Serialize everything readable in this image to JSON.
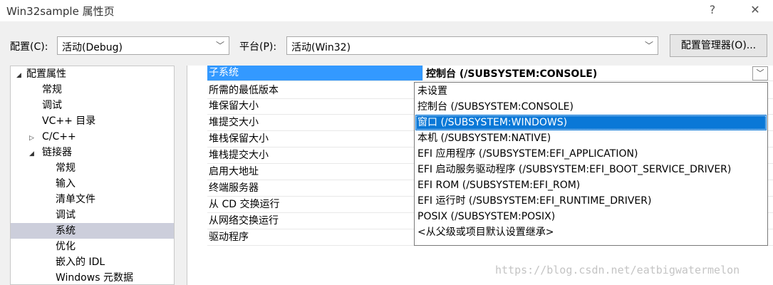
{
  "window": {
    "title": "Win32sample 属性页",
    "help_label": "?",
    "close_label": "✕"
  },
  "config_bar": {
    "config_label": "配置(C):",
    "config_value": "活动(Debug)",
    "platform_label": "平台(P):",
    "platform_value": "活动(Win32)",
    "manager_button": "配置管理器(O)..."
  },
  "tree": {
    "items": [
      {
        "label": "配置属性",
        "expander": "◢"
      },
      {
        "label": "常规"
      },
      {
        "label": "调试"
      },
      {
        "label": "VC++ 目录"
      },
      {
        "label": "C/C++",
        "expander": "▷"
      },
      {
        "label": "链接器",
        "expander": "◢"
      },
      {
        "label": "常规"
      },
      {
        "label": "输入"
      },
      {
        "label": "清单文件"
      },
      {
        "label": "调试"
      },
      {
        "label": "系统",
        "selected": true
      },
      {
        "label": "优化"
      },
      {
        "label": "嵌入的 IDL"
      },
      {
        "label": "Windows 元数据"
      }
    ]
  },
  "properties": {
    "rows": [
      {
        "name": "子系统",
        "value": "控制台 (/SUBSYSTEM:CONSOLE)",
        "selected": true
      },
      {
        "name": "所需的最低版本",
        "value": ""
      },
      {
        "name": "堆保留大小",
        "value": ""
      },
      {
        "name": "堆提交大小",
        "value": ""
      },
      {
        "name": "堆栈保留大小",
        "value": ""
      },
      {
        "name": "堆栈提交大小",
        "value": ""
      },
      {
        "name": "启用大地址",
        "value": ""
      },
      {
        "name": "终端服务器",
        "value": ""
      },
      {
        "name": "从 CD 交换运行",
        "value": ""
      },
      {
        "name": "从网络交换运行",
        "value": ""
      },
      {
        "name": "驱动程序",
        "value": ""
      }
    ]
  },
  "dropdown": {
    "options": [
      "未设置",
      "控制台 (/SUBSYSTEM:CONSOLE)",
      "窗口 (/SUBSYSTEM:WINDOWS)",
      "本机 (/SUBSYSTEM:NATIVE)",
      "EFI 应用程序 (/SUBSYSTEM:EFI_APPLICATION)",
      "EFI 启动服务驱动程序 (/SUBSYSTEM:EFI_BOOT_SERVICE_DRIVER)",
      "EFI ROM (/SUBSYSTEM:EFI_ROM)",
      "EFI 运行时 (/SUBSYSTEM:EFI_RUNTIME_DRIVER)",
      "POSIX (/SUBSYSTEM:POSIX)",
      "<从父级或项目默认设置继承>"
    ],
    "highlighted_index": 2
  },
  "watermark": "https://blog.csdn.net/eatbigwatermelon",
  "colors": {
    "selection_blue": "#3399ff",
    "dropdown_highlight": "#0a78d7",
    "tree_selection": "#cccedb"
  }
}
